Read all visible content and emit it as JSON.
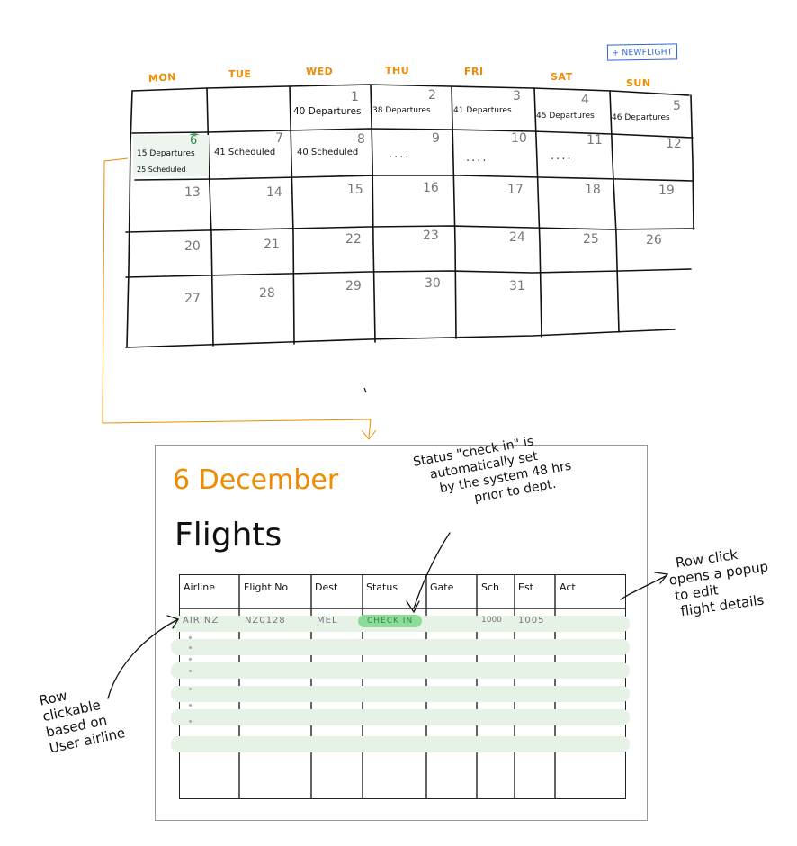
{
  "toolbar": {
    "new_flight_label": "+ NEWFLIGHT"
  },
  "calendar": {
    "day_headers": [
      "MON",
      "TUE",
      "WED",
      "THU",
      "FRI",
      "SAT",
      "SUN"
    ],
    "row1": {
      "wed": {
        "num": "1",
        "note": "40 Departures"
      },
      "thu": {
        "num": "2",
        "note": "38 Departures"
      },
      "fri": {
        "num": "3",
        "note": "41 Departures"
      },
      "sat": {
        "num": "4",
        "note": "45 Departures"
      },
      "sun": {
        "num": "5",
        "note": "46 Departures"
      }
    },
    "row2": {
      "mon": {
        "num": "6",
        "note1": "15 Departures",
        "note2": "25 Scheduled"
      },
      "tue": {
        "num": "7",
        "note": "41 Scheduled"
      },
      "wed": {
        "num": "8",
        "note": "40 Scheduled"
      },
      "thu": {
        "num": "9",
        "note": "...."
      },
      "fri": {
        "num": "10",
        "note": "...."
      },
      "sat": {
        "num": "11",
        "note": "...."
      },
      "sun": {
        "num": "12"
      }
    },
    "row3": [
      "13",
      "14",
      "15",
      "16",
      "17",
      "18",
      "19"
    ],
    "row4": [
      "20",
      "21",
      "22",
      "23",
      "24",
      "25",
      "26"
    ],
    "row5": [
      "27",
      "28",
      "29",
      "30",
      "31"
    ],
    "accent_color": "#f08a00",
    "selected_circle_color": "#2d8b45"
  },
  "detail": {
    "date": "6 December",
    "title": "Flights",
    "columns": [
      "Airline",
      "Flight No",
      "Dest",
      "Status",
      "Gate",
      "Sch",
      "Est",
      "Act"
    ],
    "rows": [
      {
        "airline": "AIR NZ",
        "flight_no": "NZ0128",
        "dest": "MEL",
        "status": "CHECK IN",
        "gate": "",
        "sch": "1000",
        "est": "1005",
        "act": ""
      }
    ]
  },
  "annotations": {
    "status_note": [
      "Status \"check in\" is",
      "automatically set",
      "by the system 48 hrs",
      "prior to dept."
    ],
    "row_click_note": [
      "Row click",
      "opens a popup",
      "to edit",
      "flight details"
    ],
    "row_clickable_note": [
      "Row",
      "clickable",
      "based on",
      "User airline"
    ]
  }
}
